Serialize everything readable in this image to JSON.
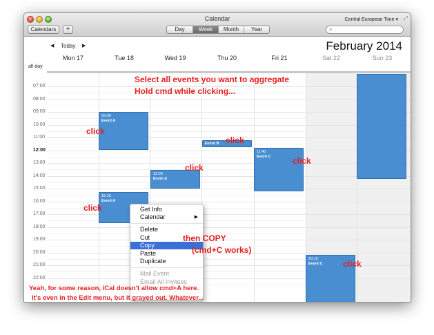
{
  "window": {
    "title": "Calendar",
    "timezone": "Central European Time ▾"
  },
  "toolbar": {
    "calendars_label": "Calendars",
    "add_label": "+",
    "views": [
      "Day",
      "Week",
      "Month",
      "Year"
    ],
    "active_view": "Week",
    "search_placeholder": ""
  },
  "nav": {
    "prev": "◀",
    "today": "Today",
    "next": "▶"
  },
  "header": {
    "month": "February",
    "year": "2014"
  },
  "days": [
    "Mon 17",
    "Tue 18",
    "Wed 19",
    "Thu 20",
    "Fri 21",
    "Sat 22",
    "Sun 23"
  ],
  "allday_label": "all-day",
  "times": [
    "07:00",
    "08:00",
    "09:00",
    "10:00",
    "11:00",
    "12:00",
    "13:00",
    "14:00",
    "15:00",
    "16:00",
    "17:00",
    "18:00",
    "19:00",
    "20:00",
    "21:00",
    "22:00"
  ],
  "events": [
    {
      "time": "09:00",
      "name": "Event A"
    },
    {
      "time": "",
      "name": "Event B"
    },
    {
      "time": "13:00",
      "name": "Event A"
    },
    {
      "time": "11:40",
      "name": "Event C"
    },
    {
      "time": "15:15",
      "name": "Event A"
    },
    {
      "time": "20:15",
      "name": "Event C"
    },
    {
      "time": "",
      "name": ""
    }
  ],
  "context_menu": {
    "items": [
      "Get Info",
      "Calendar",
      "Delete",
      "Cut",
      "Copy",
      "Paste",
      "Duplicate",
      "Mail Event",
      "Email All Invitees"
    ],
    "selected": "Copy"
  },
  "annotations": {
    "line1": "Select all events you want to aggregate",
    "line2": "Hold cmd while clicking...",
    "click": "click",
    "copy1": "then COPY",
    "copy2": "(cmd+C works)",
    "note1": "Yeah, for some reason, iCal doesn't allow cmd+A here.",
    "note2": "It's even in the Edit menu, but it grayed out. Whatever..."
  },
  "colors": {
    "event": "#4a8ed2",
    "annotation": "#e41d1d",
    "menu_highlight": "#3a6fd8"
  }
}
